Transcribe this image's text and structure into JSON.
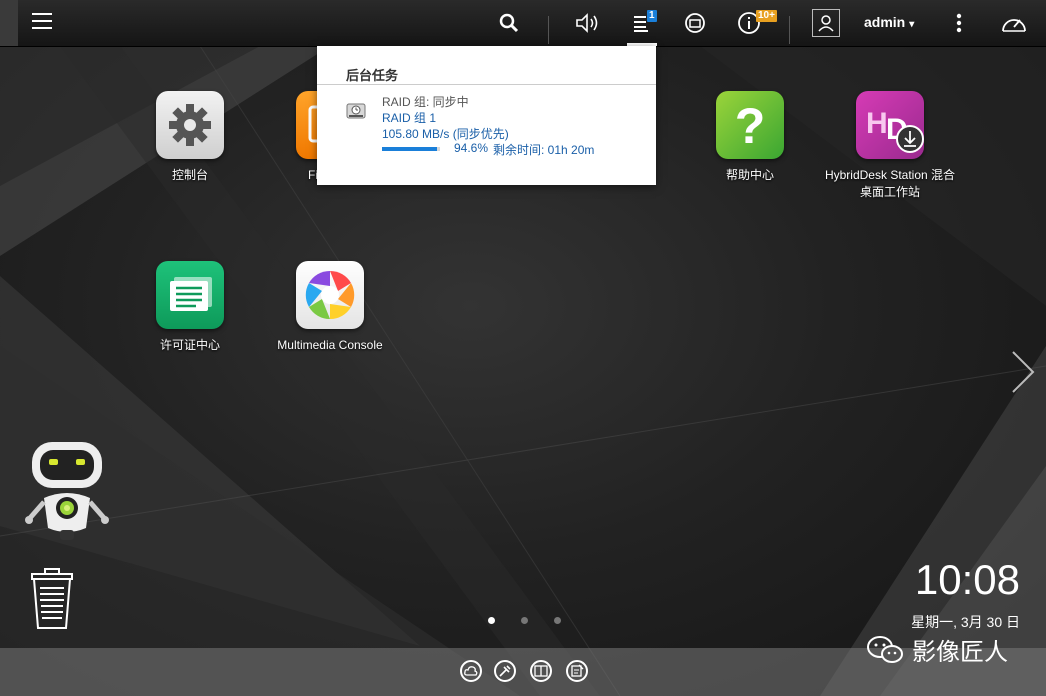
{
  "topbar": {
    "user_name": "admin",
    "caret": "▾",
    "tasks_badge": "1",
    "info_badge": "10+"
  },
  "popup": {
    "title": "后台任务",
    "task": {
      "status": "RAID 组: 同步中",
      "name": "RAID 组 1",
      "speed": "105.80 MB/s (同步优先)",
      "percent": "94.6%",
      "remaining": "剩余时间:   01h 20m",
      "progress_fraction": 0.946
    }
  },
  "apps": [
    {
      "label": "控制台",
      "icon": "gear-icon"
    },
    {
      "label": "File Stat",
      "icon": "file-station-icon"
    },
    {
      "label": "帮助中心",
      "icon": "help-icon"
    },
    {
      "label": "HybridDesk Station 混合桌面工作站",
      "icon": "hybriddesk-icon"
    },
    {
      "label": "许可证中心",
      "icon": "license-icon"
    },
    {
      "label": "Multimedia Console",
      "icon": "multimedia-icon"
    }
  ],
  "clock": {
    "time": "10:08",
    "date": "星期一, 3月 30 日"
  },
  "pages": {
    "count": 3,
    "active": 0
  },
  "watermark": "影像匠人",
  "colors": {
    "accent": "#1a7fd9",
    "badge_orange": "#e8a020",
    "link_blue": "#1a5fa8"
  }
}
